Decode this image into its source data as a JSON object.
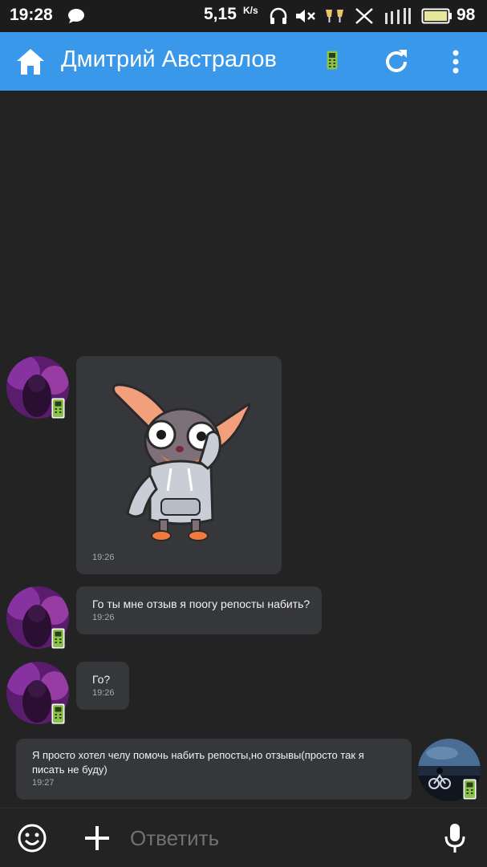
{
  "status_bar": {
    "time": "19:28",
    "net_speed": "5,15",
    "net_speed_unit": "K/s",
    "battery_percent": "98",
    "icons": [
      "chat-bubble-icon",
      "headphones-icon",
      "mute-icon",
      "cheers-icon",
      "mute-cross-icon",
      "signal-icon",
      "battery-icon"
    ]
  },
  "header": {
    "title": "Дмитрий Австралов",
    "icons": [
      "home-icon",
      "mobile-phone-icon",
      "refresh-icon",
      "more-vertical-icon"
    ],
    "bar_color": "#3a98ea"
  },
  "messages": [
    {
      "direction": "incoming",
      "type": "sticker",
      "sticker": "chihuahua-hoodie-sticker",
      "time": "19:26"
    },
    {
      "direction": "incoming",
      "type": "text",
      "text": "Го ты мне отзыв я поогу репосты набить?",
      "time": "19:26"
    },
    {
      "direction": "incoming",
      "type": "text",
      "text": "Го?",
      "time": "19:26"
    },
    {
      "direction": "outgoing",
      "type": "text",
      "line1": "Я просто хотел челу помочь набить репосты,но отзывы(просто так я",
      "line2": "писать не буду)",
      "time": "19:27"
    }
  ],
  "composer": {
    "placeholder": "Ответить",
    "icons": [
      "emoji-icon",
      "plus-icon",
      "microphone-icon"
    ]
  },
  "colors": {
    "background": "#232323",
    "bubble": "#35373b",
    "accent": "#3a98ea",
    "mobile_badge": "#8bc34a"
  }
}
